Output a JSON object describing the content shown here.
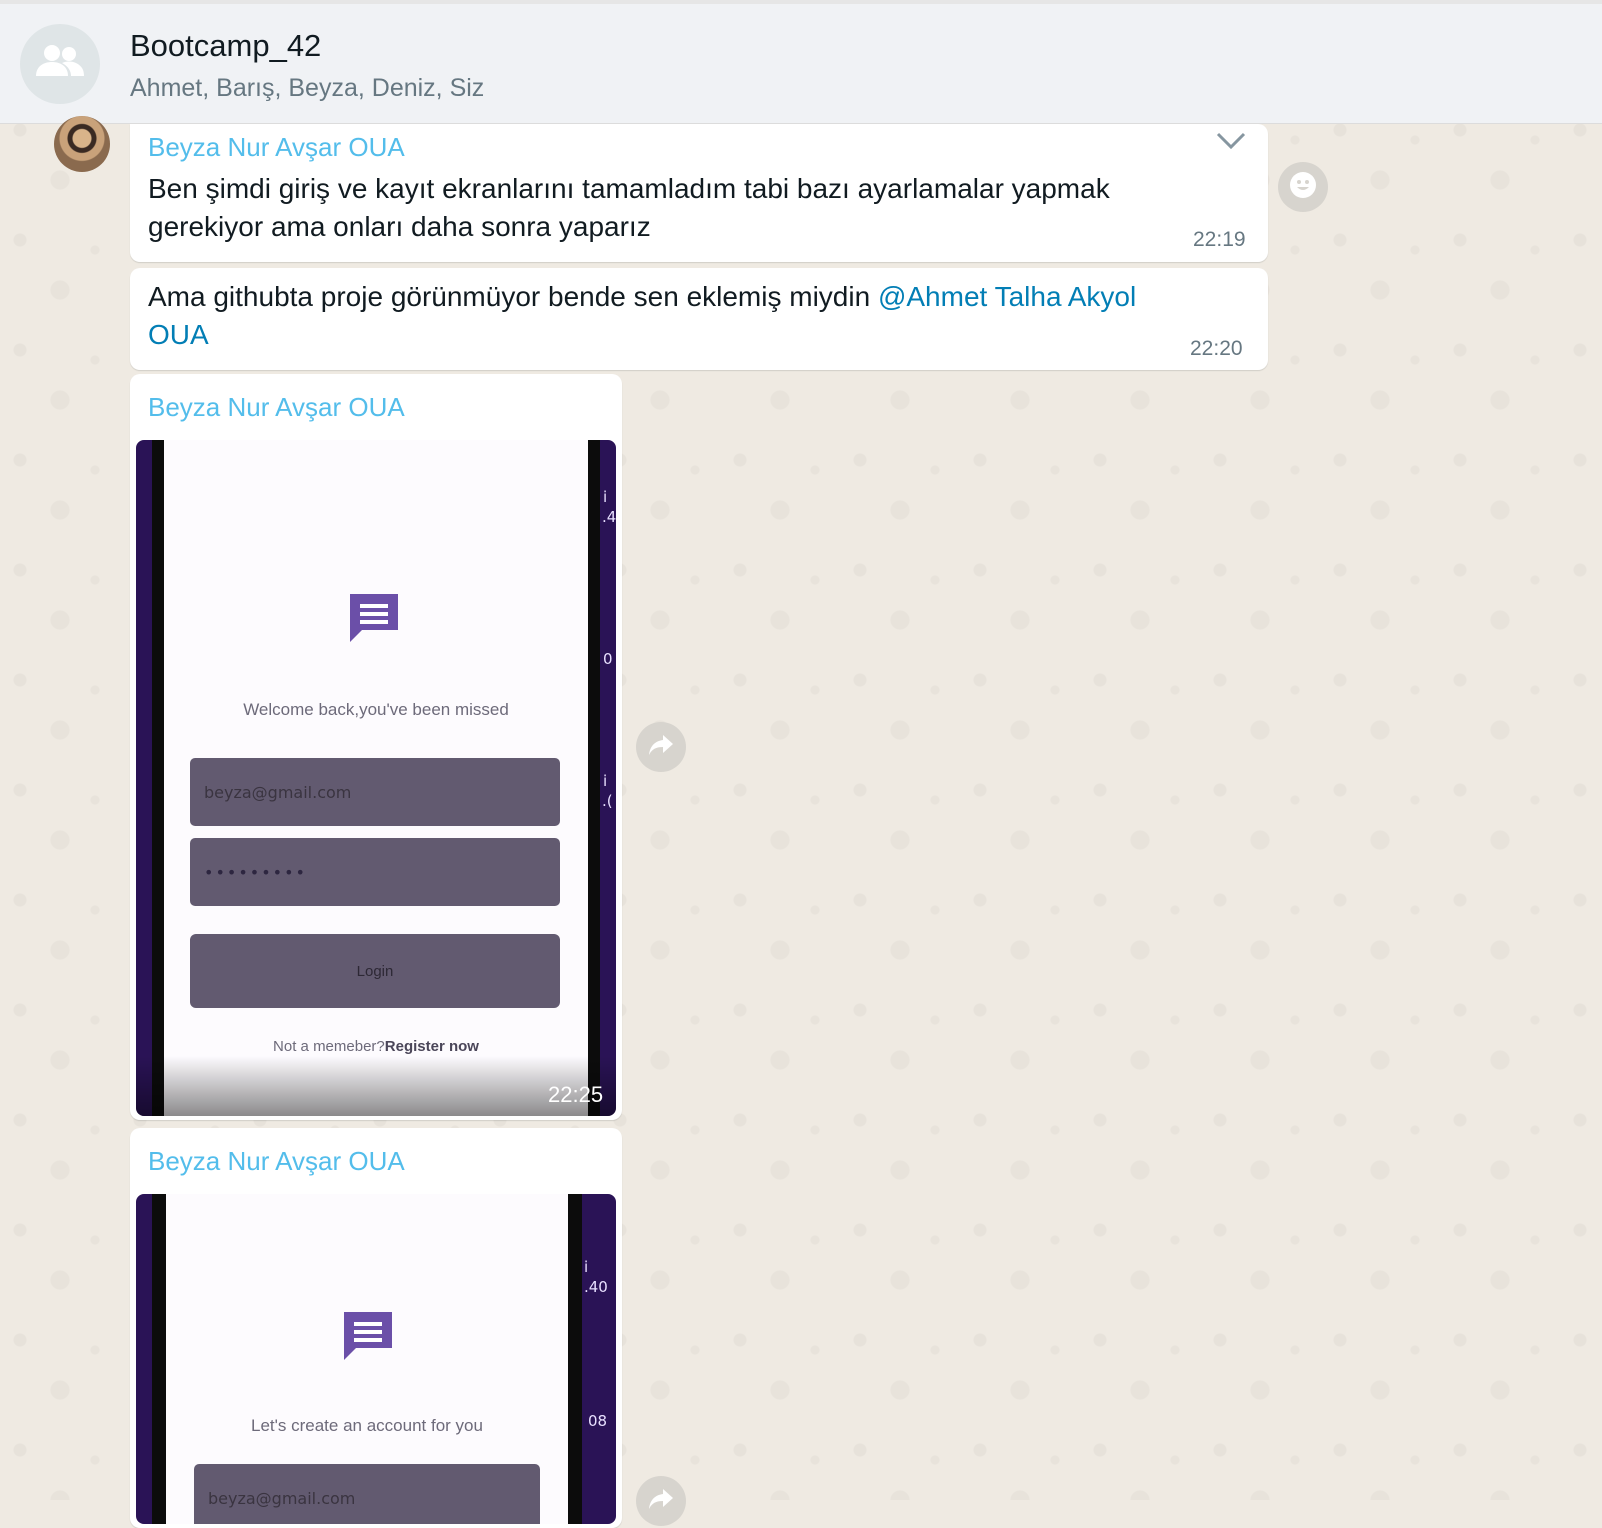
{
  "header": {
    "title": "Bootcamp_42",
    "members": "Ahmet, Barış, Beyza, Deniz, Siz",
    "avatar_icon": "group-icon"
  },
  "messages": [
    {
      "sender": "Beyza Nur Avşar OUA",
      "text": "Ben şimdi giriş ve kayıt ekranlarını tamamladım tabi bazı ayarlamalar yapmak gerekiyor ama onları daha sonra yaparız",
      "time": "22:19"
    },
    {
      "text_before": "Ama githubta proje görünmüyor bende sen eklemiş miydin ",
      "mention": "@Ahmet Talha Akyol OUA",
      "time": "22:20"
    },
    {
      "sender": "Beyza Nur Avşar OUA",
      "time": "22:25",
      "media": {
        "subtitle": "Welcome back,you've been missed",
        "email": "beyza@gmail.com",
        "password": "•••••••••",
        "button": "Login",
        "register_prefix": "Not a memeber?",
        "register_link": "Register now",
        "status_right": [
          "i",
          ".4",
          "0",
          "i",
          ".("
        ]
      }
    },
    {
      "sender": "Beyza Nur Avşar OUA",
      "media": {
        "subtitle": "Let's create an account for you",
        "email": "beyza@gmail.com",
        "status_right": [
          "i",
          ".40",
          "08"
        ]
      }
    }
  ],
  "colors": {
    "sender": "#53bdeb",
    "mention": "#027eb5",
    "app_icon": "#6b4fa8",
    "input_fill": "#625a70"
  }
}
